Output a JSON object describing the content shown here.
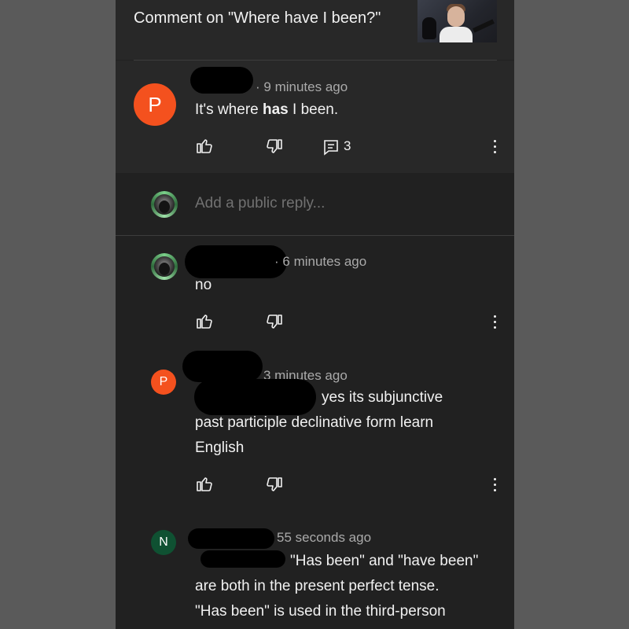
{
  "header": {
    "title": "Comment on \"Where have I been?\""
  },
  "main_comment": {
    "avatar_letter": "P",
    "avatar_color": "#f4511e",
    "time": "9 minutes ago",
    "text_before": "It's where ",
    "text_bold": "has",
    "text_after": " I been.",
    "reply_count": "3"
  },
  "reply_box": {
    "placeholder": "Add a public reply..."
  },
  "replies": [
    {
      "avatar": "ring",
      "time": "6 minutes ago",
      "text": "no"
    },
    {
      "avatar_letter": "P",
      "avatar_color": "#f4511e",
      "time": "3 minutes ago",
      "line1": "yes its subjunctive",
      "line2": "past participle declinative form learn",
      "line3": "English"
    },
    {
      "avatar_letter": "N",
      "avatar_color": "#0f5132",
      "time": "55 seconds ago",
      "line1": "\"Has been\" and \"have been\"",
      "line2": "are both in the present perfect tense.",
      "line3": "\"Has been\" is used in the third-person"
    }
  ],
  "icons": [
    "thumb-up-icon",
    "thumb-down-icon",
    "reply-icon",
    "more-vert-icon"
  ]
}
